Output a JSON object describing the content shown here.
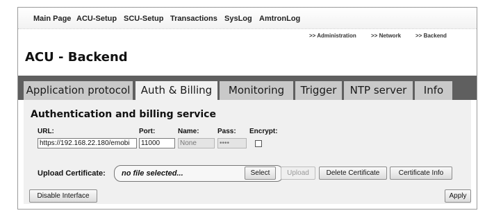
{
  "nav": {
    "items": [
      "Main Page",
      "ACU-Setup",
      "SCU-Setup",
      "Transactions",
      "SysLog",
      "AmtronLog"
    ]
  },
  "breadcrumb": {
    "items": [
      ">> Administration",
      ">> Network",
      ">> Backend"
    ]
  },
  "page": {
    "title": "ACU - Backend"
  },
  "tabs": [
    {
      "label": "Application protocol",
      "active": false
    },
    {
      "label": "Auth & Billing",
      "active": true
    },
    {
      "label": "Monitoring",
      "active": false
    },
    {
      "label": "Trigger",
      "active": false
    },
    {
      "label": "NTP server",
      "active": false
    },
    {
      "label": "Info",
      "active": false
    }
  ],
  "section": {
    "title": "Authentication and billing service"
  },
  "form": {
    "url_label": "URL:",
    "url_value": "https://192.168.22.180/emobi",
    "port_label": "Port:",
    "port_value": "11000",
    "name_label": "Name:",
    "name_value": "None",
    "pass_label": "Pass:",
    "pass_value": "••••",
    "encrypt_label": "Encrypt:",
    "encrypt_checked": false
  },
  "upload": {
    "label": "Upload Certificate:",
    "file_text": "no file selected...",
    "select_label": "Select",
    "upload_label": "Upload",
    "delete_label": "Delete Certificate",
    "info_label": "Certificate Info"
  },
  "footer": {
    "disable_label": "Disable Interface",
    "apply_label": "Apply"
  }
}
